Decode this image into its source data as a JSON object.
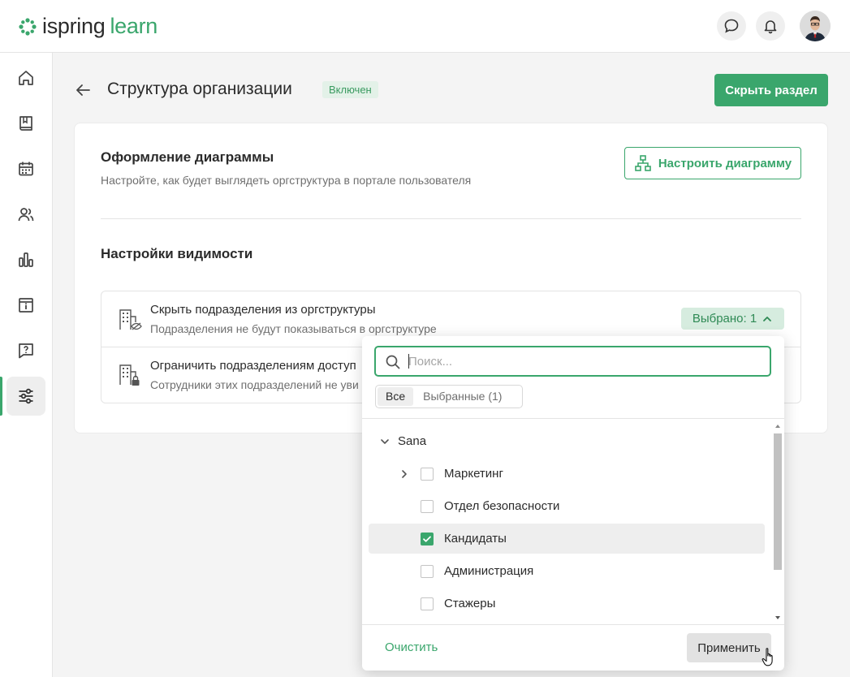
{
  "header": {
    "logo_main": "ispring",
    "logo_accent": "learn",
    "chat_icon": "chat-bubble-icon",
    "notifications_icon": "bell-icon"
  },
  "sidebar": {
    "items": [
      {
        "icon": "home-icon"
      },
      {
        "icon": "book-icon"
      },
      {
        "icon": "calendar-icon"
      },
      {
        "icon": "users-icon"
      },
      {
        "icon": "bar-chart-icon"
      },
      {
        "icon": "info-box-icon"
      },
      {
        "icon": "question-chat-icon"
      },
      {
        "icon": "sliders-icon",
        "active": true
      }
    ]
  },
  "page": {
    "title": "Структура организации",
    "status": "Включен",
    "hide_button": "Скрыть раздел"
  },
  "diagram": {
    "title": "Оформление диаграммы",
    "description": "Настройте, как будет выглядеть оргструктура в портале пользователя",
    "button": "Настроить диаграмму"
  },
  "visibility": {
    "title": "Настройки видимости",
    "rows": [
      {
        "title": "Скрыть подразделения из оргструктуры",
        "description": "Подразделения не будут показываться в оргструктуре"
      },
      {
        "title": "Ограничить подразделениям доступ",
        "description": "Сотрудники этих подразделений не уви"
      }
    ],
    "selected_chip": "Выбрано: 1"
  },
  "dropdown": {
    "search_placeholder": "Поиск...",
    "tabs": [
      "Все",
      "Выбранные (1)"
    ],
    "active_tab": "Все",
    "tree": [
      {
        "label": "Sana",
        "level": 0,
        "expanded": true,
        "checkbox": false
      },
      {
        "label": "Маркетинг",
        "level": 1,
        "expandable": true,
        "checked": false
      },
      {
        "label": "Отдел безопасности",
        "level": 1,
        "checked": false
      },
      {
        "label": "Кандидаты",
        "level": 1,
        "checked": true
      },
      {
        "label": "Администрация",
        "level": 1,
        "checked": false
      },
      {
        "label": "Стажеры",
        "level": 1,
        "checked": false
      }
    ],
    "clear": "Очистить",
    "apply": "Применить"
  },
  "colors": {
    "brand": "#3aa66c",
    "badge_bg": "#e3f1e8",
    "chip_bg": "#d6ecdf"
  }
}
